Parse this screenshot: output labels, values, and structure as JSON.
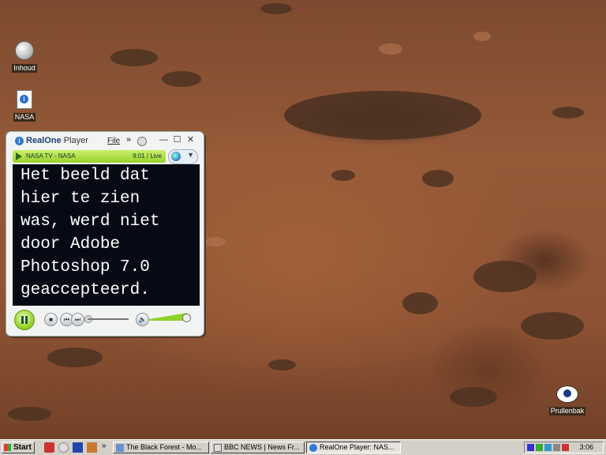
{
  "desktop": {
    "icons": [
      {
        "label": "Inhoud",
        "icon": "globe-icon"
      },
      {
        "label": "NASA",
        "icon": "realplayer-file-icon"
      },
      {
        "label": "Prullenbak",
        "icon": "recycle-bin-icon"
      }
    ]
  },
  "player": {
    "app_name_bold": "RealOne",
    "app_name_light": " Player",
    "menu_file": "File",
    "menu_more": "»",
    "win_minimize": "—",
    "win_maximize": "☐",
    "win_close": "✕",
    "now_playing": "NASA TV - NASA",
    "time": "9:01 / Live",
    "dropdown_arrow": "▼",
    "video_message": "Het beeld dat\nhier te zien\nwas, werd niet\ndoor Adobe\nPhotoshop 7.0\ngeaccepteerd.",
    "stop_symbol": "■",
    "prev_symbol": "⏮",
    "next_symbol": "⏭",
    "volume_symbol": "🔈",
    "volume_level": 0.95,
    "accent_color": "#9bd42a"
  },
  "taskbar": {
    "start_label": "Start",
    "chevron": "»",
    "tasks": [
      {
        "label": "The Black Forest - Mo...",
        "active": false
      },
      {
        "label": "BBC NEWS | News Fr...",
        "active": false
      },
      {
        "label": "RealOne Player: NAS...",
        "active": true
      }
    ],
    "clock": "3:06"
  }
}
